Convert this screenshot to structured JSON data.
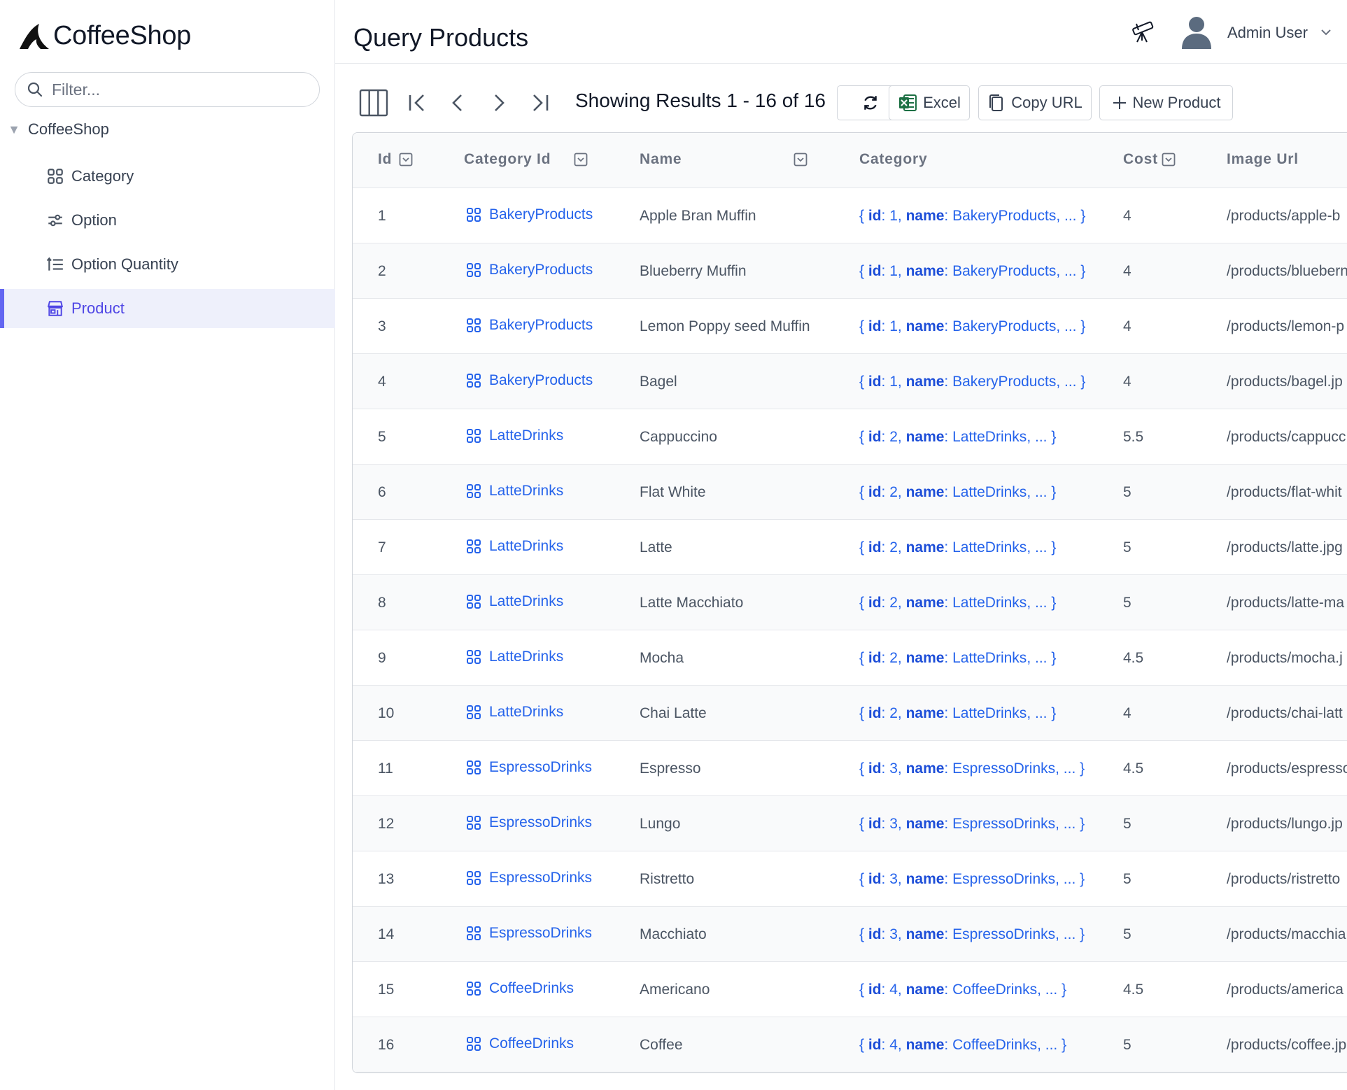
{
  "app": {
    "brand": "CoffeeShop"
  },
  "sidebar": {
    "filter_placeholder": "Filter...",
    "root_label": "CoffeeShop",
    "items": [
      {
        "label": "Category",
        "icon": "grid-icon"
      },
      {
        "label": "Option",
        "icon": "sliders-icon"
      },
      {
        "label": "Option Quantity",
        "icon": "sort-list-icon"
      },
      {
        "label": "Product",
        "icon": "store-icon"
      }
    ],
    "active_item": "Product"
  },
  "header": {
    "title": "Query Products",
    "user_name": "Admin User"
  },
  "toolbar": {
    "results_text": "Showing Results 1 - 16 of 16",
    "excel_label": "Excel",
    "copy_url_label": "Copy URL",
    "new_label": "New Product"
  },
  "table": {
    "columns": [
      "Id",
      "Category Id",
      "Name",
      "Category",
      "Cost",
      "Image Url"
    ],
    "rows": [
      {
        "id": "1",
        "category_id": "BakeryProducts",
        "name": "Apple Bran Muffin",
        "cat_id": "1",
        "cat_name": "BakeryProducts",
        "cost": "4",
        "image_url": "/products/apple-b"
      },
      {
        "id": "2",
        "category_id": "BakeryProducts",
        "name": "Blueberry Muffin",
        "cat_id": "1",
        "cat_name": "BakeryProducts",
        "cost": "4",
        "image_url": "/products/bluebern"
      },
      {
        "id": "3",
        "category_id": "BakeryProducts",
        "name": "Lemon Poppy seed Muffin",
        "cat_id": "1",
        "cat_name": "BakeryProducts",
        "cost": "4",
        "image_url": "/products/lemon-p"
      },
      {
        "id": "4",
        "category_id": "BakeryProducts",
        "name": "Bagel",
        "cat_id": "1",
        "cat_name": "BakeryProducts",
        "cost": "4",
        "image_url": "/products/bagel.jp"
      },
      {
        "id": "5",
        "category_id": "LatteDrinks",
        "name": "Cappuccino",
        "cat_id": "2",
        "cat_name": "LatteDrinks",
        "cost": "5.5",
        "image_url": "/products/cappucc"
      },
      {
        "id": "6",
        "category_id": "LatteDrinks",
        "name": "Flat White",
        "cat_id": "2",
        "cat_name": "LatteDrinks",
        "cost": "5",
        "image_url": "/products/flat-whit"
      },
      {
        "id": "7",
        "category_id": "LatteDrinks",
        "name": "Latte",
        "cat_id": "2",
        "cat_name": "LatteDrinks",
        "cost": "5",
        "image_url": "/products/latte.jpg"
      },
      {
        "id": "8",
        "category_id": "LatteDrinks",
        "name": "Latte Macchiato",
        "cat_id": "2",
        "cat_name": "LatteDrinks",
        "cost": "5",
        "image_url": "/products/latte-ma"
      },
      {
        "id": "9",
        "category_id": "LatteDrinks",
        "name": "Mocha",
        "cat_id": "2",
        "cat_name": "LatteDrinks",
        "cost": "4.5",
        "image_url": "/products/mocha.j"
      },
      {
        "id": "10",
        "category_id": "LatteDrinks",
        "name": "Chai Latte",
        "cat_id": "2",
        "cat_name": "LatteDrinks",
        "cost": "4",
        "image_url": "/products/chai-latt"
      },
      {
        "id": "11",
        "category_id": "EspressoDrinks",
        "name": "Espresso",
        "cat_id": "3",
        "cat_name": "EspressoDrinks",
        "cost": "4.5",
        "image_url": "/products/espresso"
      },
      {
        "id": "12",
        "category_id": "EspressoDrinks",
        "name": "Lungo",
        "cat_id": "3",
        "cat_name": "EspressoDrinks",
        "cost": "5",
        "image_url": "/products/lungo.jp"
      },
      {
        "id": "13",
        "category_id": "EspressoDrinks",
        "name": "Ristretto",
        "cat_id": "3",
        "cat_name": "EspressoDrinks",
        "cost": "5",
        "image_url": "/products/ristretto"
      },
      {
        "id": "14",
        "category_id": "EspressoDrinks",
        "name": "Macchiato",
        "cat_id": "3",
        "cat_name": "EspressoDrinks",
        "cost": "5",
        "image_url": "/products/macchia"
      },
      {
        "id": "15",
        "category_id": "CoffeeDrinks",
        "name": "Americano",
        "cat_id": "4",
        "cat_name": "CoffeeDrinks",
        "cost": "4.5",
        "image_url": "/products/america"
      },
      {
        "id": "16",
        "category_id": "CoffeeDrinks",
        "name": "Coffee",
        "cat_id": "4",
        "cat_name": "CoffeeDrinks",
        "cost": "5",
        "image_url": "/products/coffee.jp"
      }
    ]
  },
  "colors": {
    "accent": "#6366f1",
    "active_bg": "#eef0fb",
    "link": "#2563eb",
    "excel_green": "#1d7044"
  }
}
